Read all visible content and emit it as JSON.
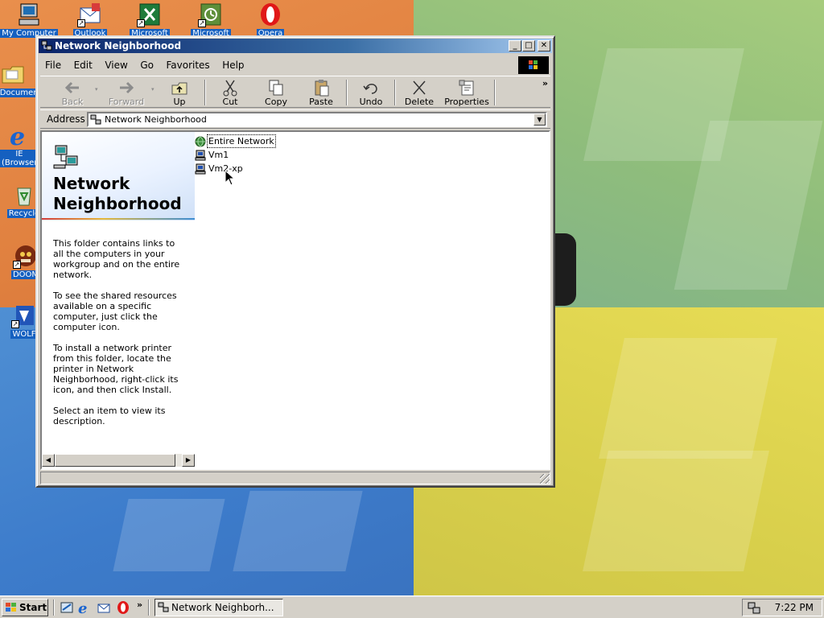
{
  "desktop": {
    "icons": [
      {
        "label": "My Computer"
      },
      {
        "label": "Outlook"
      },
      {
        "label": "Microsoft"
      },
      {
        "label": "Microsoft"
      },
      {
        "label": "Opera"
      },
      {
        "label": "My Documents"
      },
      {
        "label": "IE (Browser)"
      },
      {
        "label": "Recycle"
      },
      {
        "label": "DOOM"
      },
      {
        "label": "WOLF"
      }
    ]
  },
  "window": {
    "title": "Network Neighborhood",
    "menus": [
      "File",
      "Edit",
      "View",
      "Go",
      "Favorites",
      "Help"
    ],
    "toolbar": {
      "back": "Back",
      "forward": "Forward",
      "up": "Up",
      "cut": "Cut",
      "copy": "Copy",
      "paste": "Paste",
      "undo": "Undo",
      "delete": "Delete",
      "properties": "Properties",
      "more": "»"
    },
    "address": {
      "label": "Address",
      "value": "Network Neighborhood"
    },
    "webview": {
      "title": "Network Neighborhood",
      "paragraphs": [
        "This folder contains links to all the computers in your workgroup and on the entire network.",
        "To see the shared resources available on a specific computer, just click the computer icon.",
        "To install a network printer from this folder, locate the printer in Network Neighborhood, right-click its icon, and then click Install.",
        "Select an item to view its description."
      ]
    },
    "items": [
      {
        "label": "Entire Network",
        "icon": "globe-icon"
      },
      {
        "label": "Vm1",
        "icon": "computer-icon"
      },
      {
        "label": "Vm2-xp",
        "icon": "computer-icon"
      }
    ]
  },
  "taskbar": {
    "start_label": "Start",
    "task_label": "Network Neighborh...",
    "quicklaunch_more": "»",
    "clock": "7:22 PM"
  }
}
